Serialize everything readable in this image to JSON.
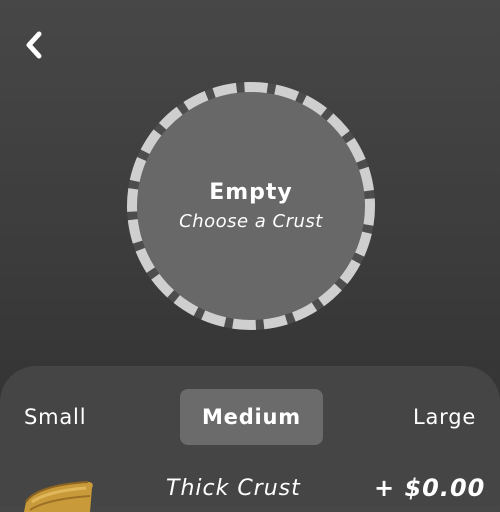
{
  "nav": {
    "back_icon": "chevron-left-icon"
  },
  "pizza": {
    "title": "Empty",
    "subtitle": "Choose a Crust"
  },
  "sizes": {
    "small": "Small",
    "medium": "Medium",
    "large": "Large",
    "selected": "Medium"
  },
  "crust_item": {
    "name": "Thick Crust",
    "price": "+ $0.00",
    "icon": "bread-icon"
  },
  "colors": {
    "background_top": "#474747",
    "background_bottom": "#2f2f2f",
    "plate_fill": "#686868",
    "plate_ring_dash": "#cfcfcf",
    "plate_ring_base": "#4d4d4d",
    "sheet": "#454545",
    "selected_size": "#6b6b6b",
    "crust": "#b8892f"
  }
}
